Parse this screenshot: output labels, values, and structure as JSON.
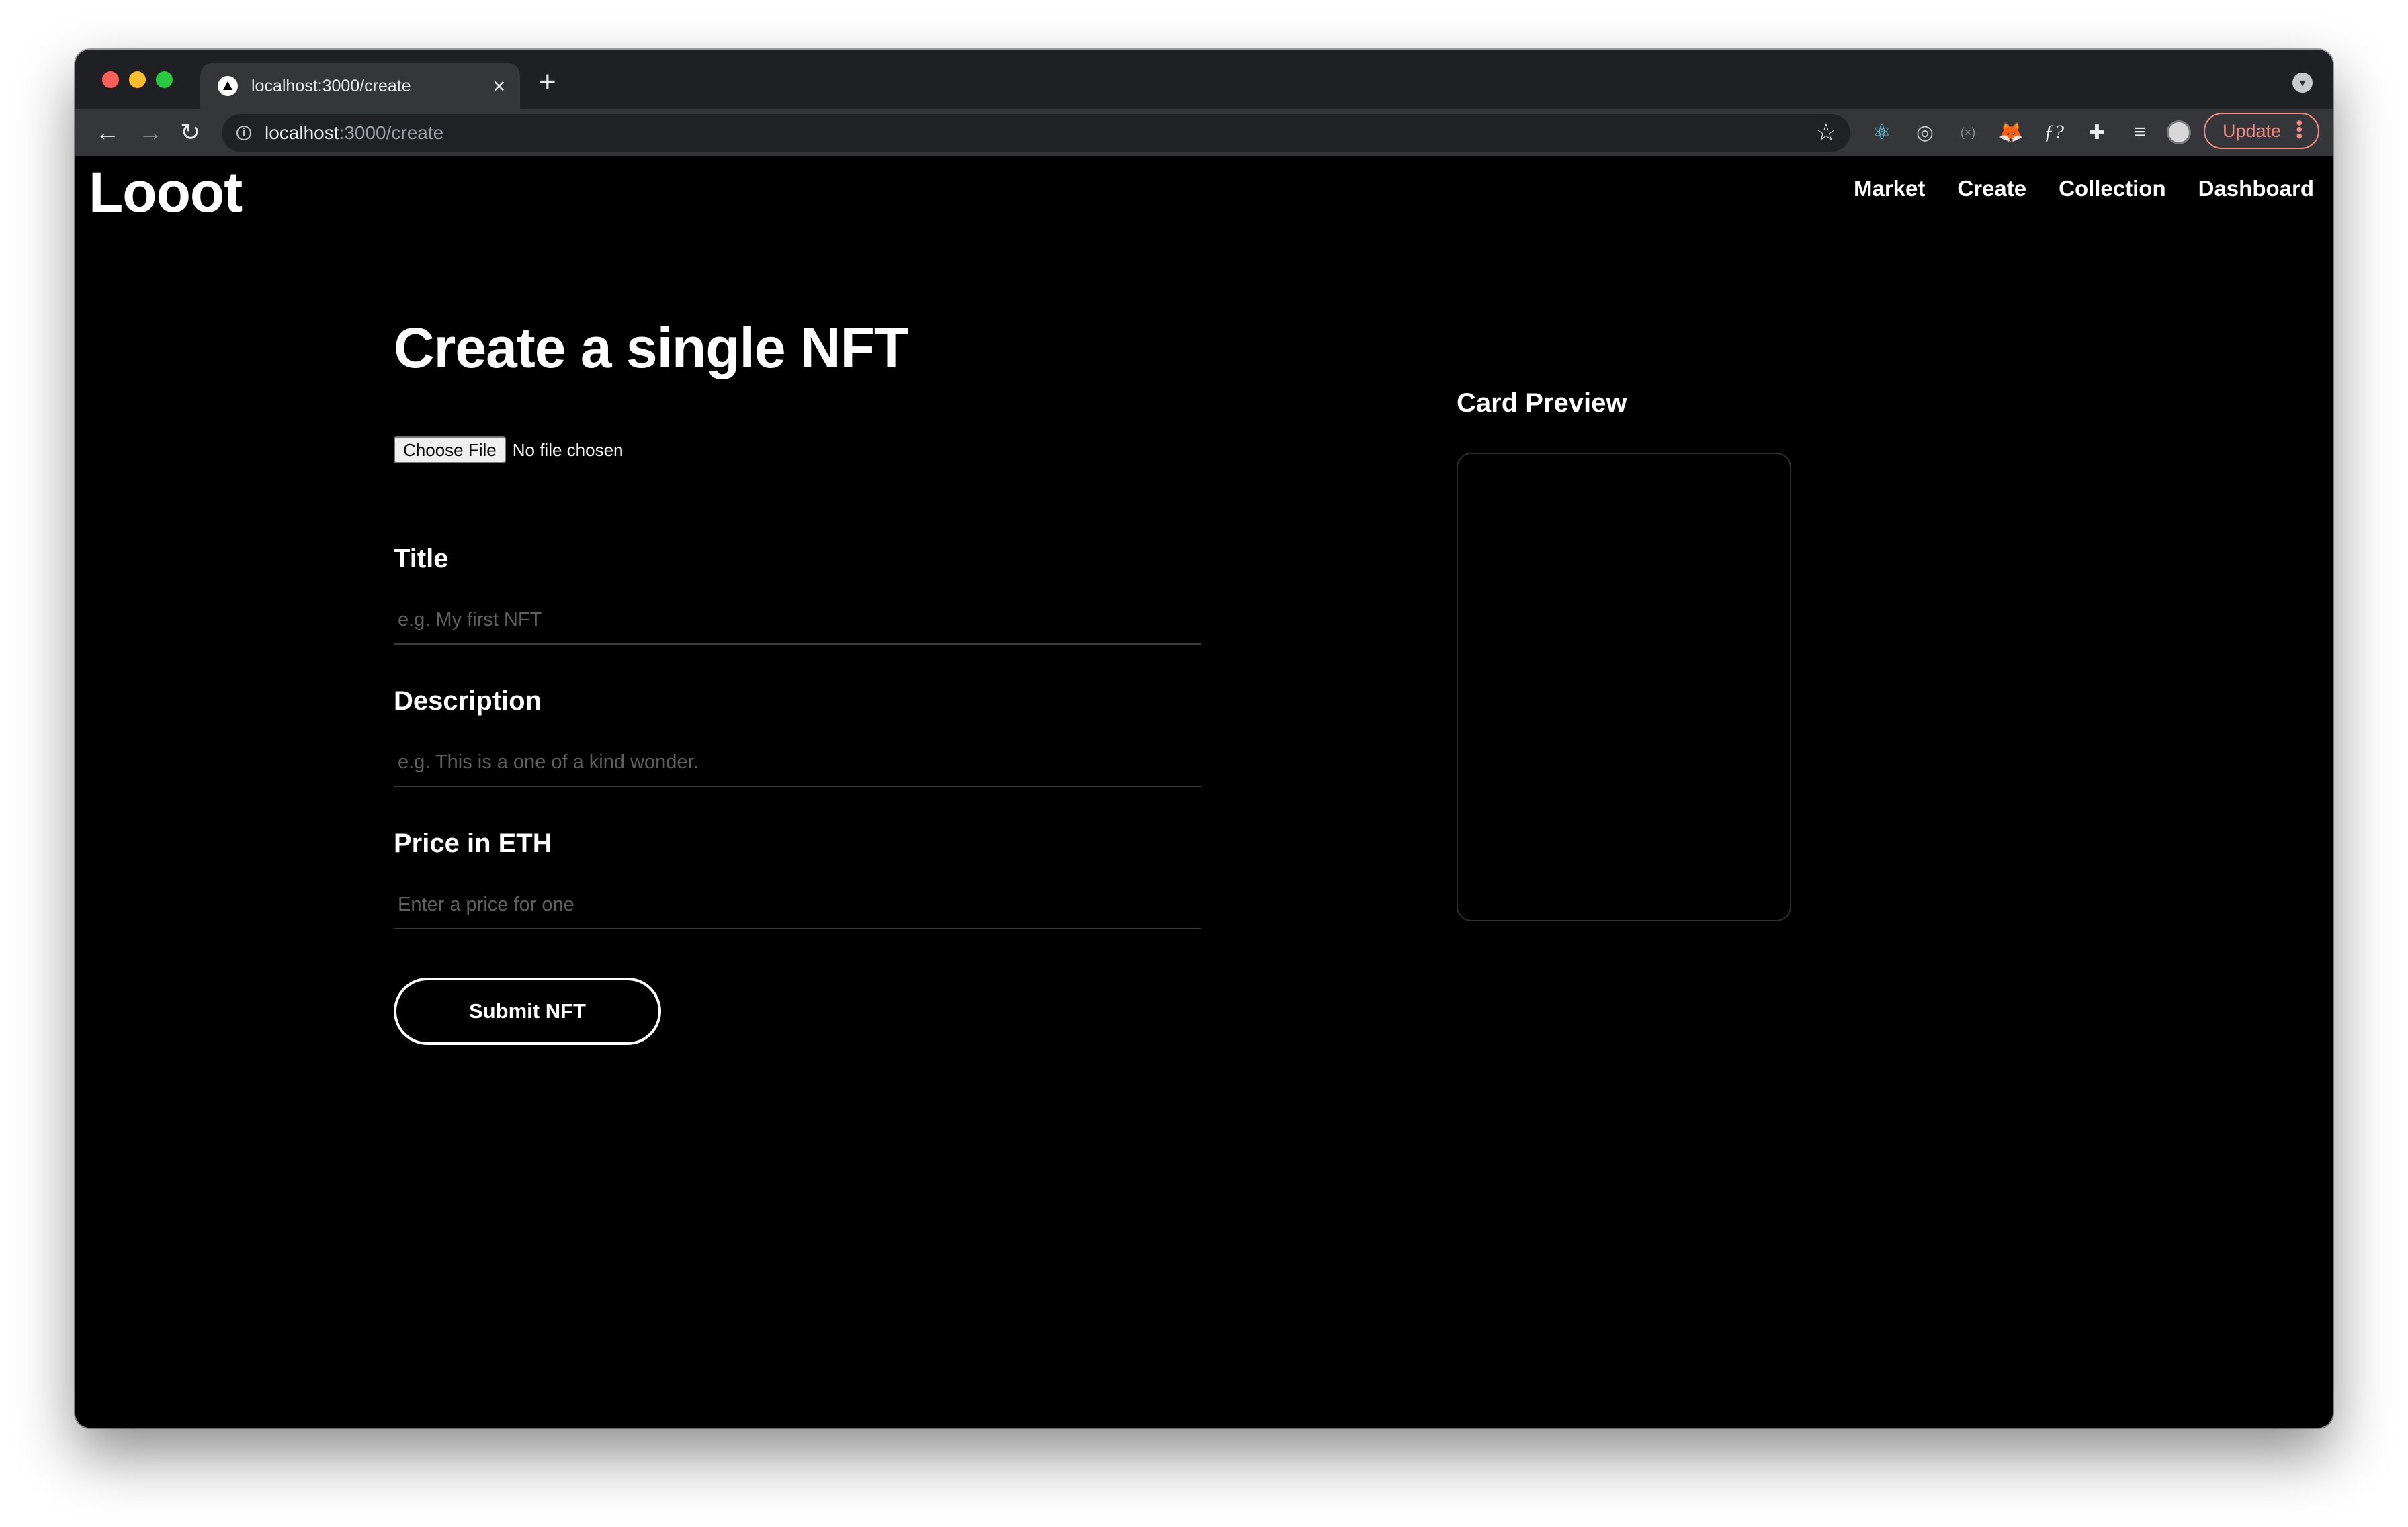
{
  "browser": {
    "tab_title": "localhost:3000/create",
    "tab_close": "×",
    "new_tab": "+",
    "url_host": "localhost",
    "url_path": ":3000/create",
    "update_label": "Update",
    "traffic_lights": [
      "#ff5f57",
      "#febc2e",
      "#28c840"
    ],
    "extensions": [
      "react-devtools-icon",
      "target-icon",
      "bracket-icon",
      "metamask-fox-icon",
      "font-icon",
      "puzzle-icon",
      "media-queue-icon",
      "profile-avatar-icon"
    ]
  },
  "site": {
    "logo": "Looot",
    "nav": [
      "Market",
      "Create",
      "Collection",
      "Dashboard"
    ]
  },
  "form": {
    "heading": "Create a single NFT",
    "file_button": "Choose File",
    "file_status": "No file chosen",
    "title_label": "Title",
    "title_placeholder": "e.g. My first NFT",
    "description_label": "Description",
    "description_placeholder": "e.g. This is a one of a kind wonder.",
    "price_label": "Price in ETH",
    "price_placeholder": "Enter a price for one",
    "submit_label": "Submit NFT"
  },
  "preview": {
    "title": "Card Preview"
  }
}
